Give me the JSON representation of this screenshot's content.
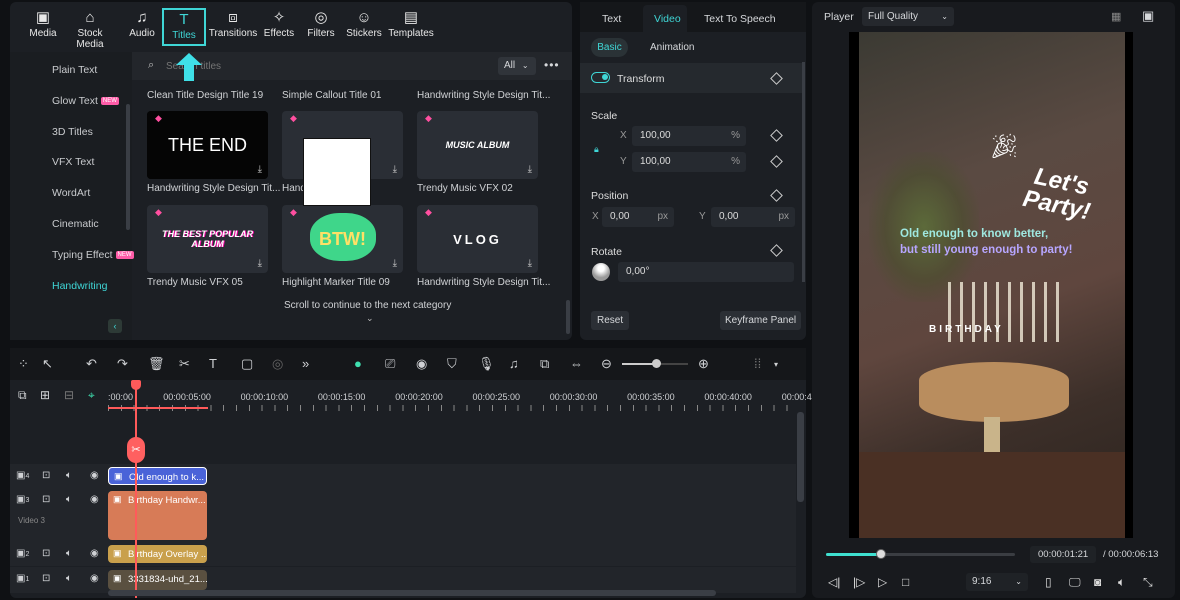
{
  "top_tabs": [
    {
      "label": "Media",
      "icon": "media-icon"
    },
    {
      "label": "Stock Media",
      "icon": "stock-media-icon"
    },
    {
      "label": "Audio",
      "icon": "music-note-icon"
    },
    {
      "label": "Titles",
      "icon": "titles-icon",
      "active": true
    },
    {
      "label": "Transitions",
      "icon": "transitions-icon"
    },
    {
      "label": "Effects",
      "icon": "effects-icon"
    },
    {
      "label": "Filters",
      "icon": "filters-icon"
    },
    {
      "label": "Stickers",
      "icon": "stickers-icon"
    },
    {
      "label": "Templates",
      "icon": "templates-icon"
    }
  ],
  "sidebar": [
    {
      "label": "Plain Text"
    },
    {
      "label": "Glow Text",
      "badge": "NEW"
    },
    {
      "label": "3D Titles"
    },
    {
      "label": "VFX Text"
    },
    {
      "label": "WordArt"
    },
    {
      "label": "Cinematic"
    },
    {
      "label": "Typing Effect",
      "badge": "NEW"
    },
    {
      "label": "Handwriting",
      "active": true
    }
  ],
  "search": {
    "placeholder": "Search titles",
    "filter": "All"
  },
  "row_titles": [
    "Clean Title Design Title 19",
    "Simple Callout Title 01",
    "Handwriting Style Design Tit..."
  ],
  "items": [
    {
      "label": "Handwriting Style Design Tit...",
      "art": "THE END"
    },
    {
      "label": "Hand",
      "art": ""
    },
    {
      "label": "Trendy Music VFX 02",
      "art": "MUSIC ALBUM"
    },
    {
      "label": "Trendy Music VFX 05",
      "art": "THE BEST POPULAR ALBUM"
    },
    {
      "label": "Highlight Marker Title 09",
      "art": "BTW!"
    },
    {
      "label": "Handwriting Style Design Tit...",
      "art": "VLOG"
    }
  ],
  "scroll_hint": "Scroll to continue to the next category",
  "props": {
    "tabs": [
      "Text",
      "Video",
      "Text To Speech"
    ],
    "active_tab": "Video",
    "subtabs": [
      "Basic",
      "Animation"
    ],
    "transform": "Transform",
    "transform_on": true,
    "scale": "Scale",
    "scale_x": "100,00",
    "scale_y": "100,00",
    "pct": "%",
    "position": "Position",
    "pos_x": "0,00",
    "pos_y": "0,00",
    "px": "px",
    "x": "X",
    "y": "Y",
    "rotate": "Rotate",
    "rotate_val": "0,00°",
    "reset": "Reset",
    "keyframe": "Keyframe Panel"
  },
  "player": {
    "label": "Player",
    "quality": "Full Quality",
    "current": "00:00:01:21",
    "total": "/ 00:00:06:13",
    "progress_pct": 29,
    "ratio": "9:16",
    "overlay_title": "Let's Party!",
    "overlay_line1": "Old enough to know better,",
    "overlay_line2": "but still young enough to party!",
    "cake_letters": "BIRTHDAY"
  },
  "timeline": {
    "ticks": [
      ":00:00",
      "00:00:05:00",
      "00:00:10:00",
      "00:00:15:00",
      "00:00:20:00",
      "00:00:25:00",
      "00:00:30:00",
      "00:00:35:00",
      "00:00:40:00",
      "00:00:4"
    ],
    "tracks": [
      {
        "num": "4",
        "clip": "Old enough to k...",
        "color": "#4a63d8"
      },
      {
        "num": "3",
        "name": "Video 3",
        "clip": "Birthday Handwr...",
        "color": "#d77b57"
      },
      {
        "num": "2",
        "clip": "Birthday Overlay ...",
        "color": "#c9a04c"
      },
      {
        "num": "1",
        "clip": "3331834-uhd_21...",
        "color": "#5a5040"
      }
    ]
  },
  "colors": {
    "accent": "#3fd6d6",
    "playhead": "#ff5a5a",
    "bg": "#1c1f24"
  }
}
